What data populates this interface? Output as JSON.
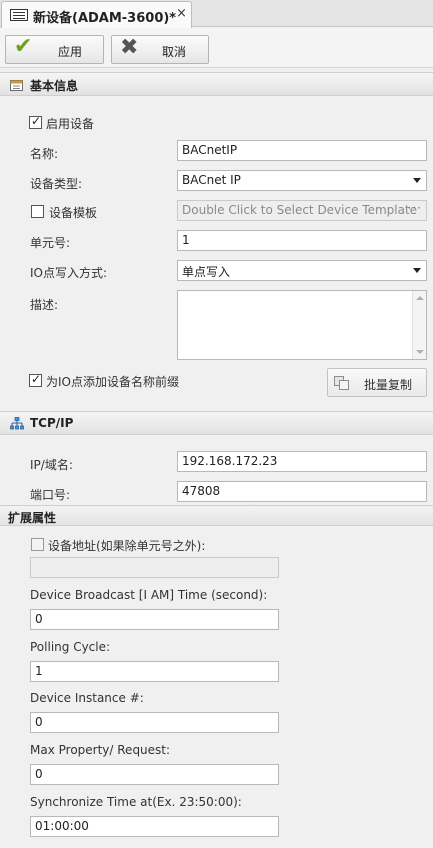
{
  "tab": {
    "title": "新设备(ADAM-3600)*",
    "close": "×"
  },
  "toolbar": {
    "apply_label": "应用",
    "cancel_label": "取消"
  },
  "basic": {
    "section_title": "基本信息",
    "enable_label": "启用设备",
    "enable_checked": true,
    "name_label": "名称:",
    "name_value": "BACnetIP",
    "type_label": "设备类型:",
    "type_value": "BACnet IP",
    "template_label": "设备模板",
    "template_checked": false,
    "template_placeholder": "Double Click to Select Device Template",
    "template_dots": "···",
    "unit_label": "单元号:",
    "unit_value": "1",
    "io_write_label": "IO点写入方式:",
    "io_write_value": "单点写入",
    "desc_label": "描述:",
    "desc_value": "",
    "prefix_label": "为IO点添加设备名称前缀",
    "prefix_checked": true,
    "batch_copy_label": "批量复制"
  },
  "tcpip": {
    "section_title": "TCP/IP",
    "ip_label": "IP/域名:",
    "ip_value": "192.168.172.23",
    "port_label": "端口号:",
    "port_value": "47808"
  },
  "ext": {
    "section_title": "扩展属性",
    "device_addr_label": "设备地址(如果除单元号之外):",
    "device_addr_value": "",
    "broadcast_label": "Device Broadcast [I AM] Time (second):",
    "broadcast_value": "0",
    "polling_label": "Polling Cycle:",
    "polling_value": "1",
    "instance_label": "Device Instance #:",
    "instance_value": "0",
    "maxprop_label": "Max Property/ Request:",
    "maxprop_value": "0",
    "sync_label": "Synchronize Time at(Ex. 23:50:00):",
    "sync_value": "01:00:00"
  }
}
